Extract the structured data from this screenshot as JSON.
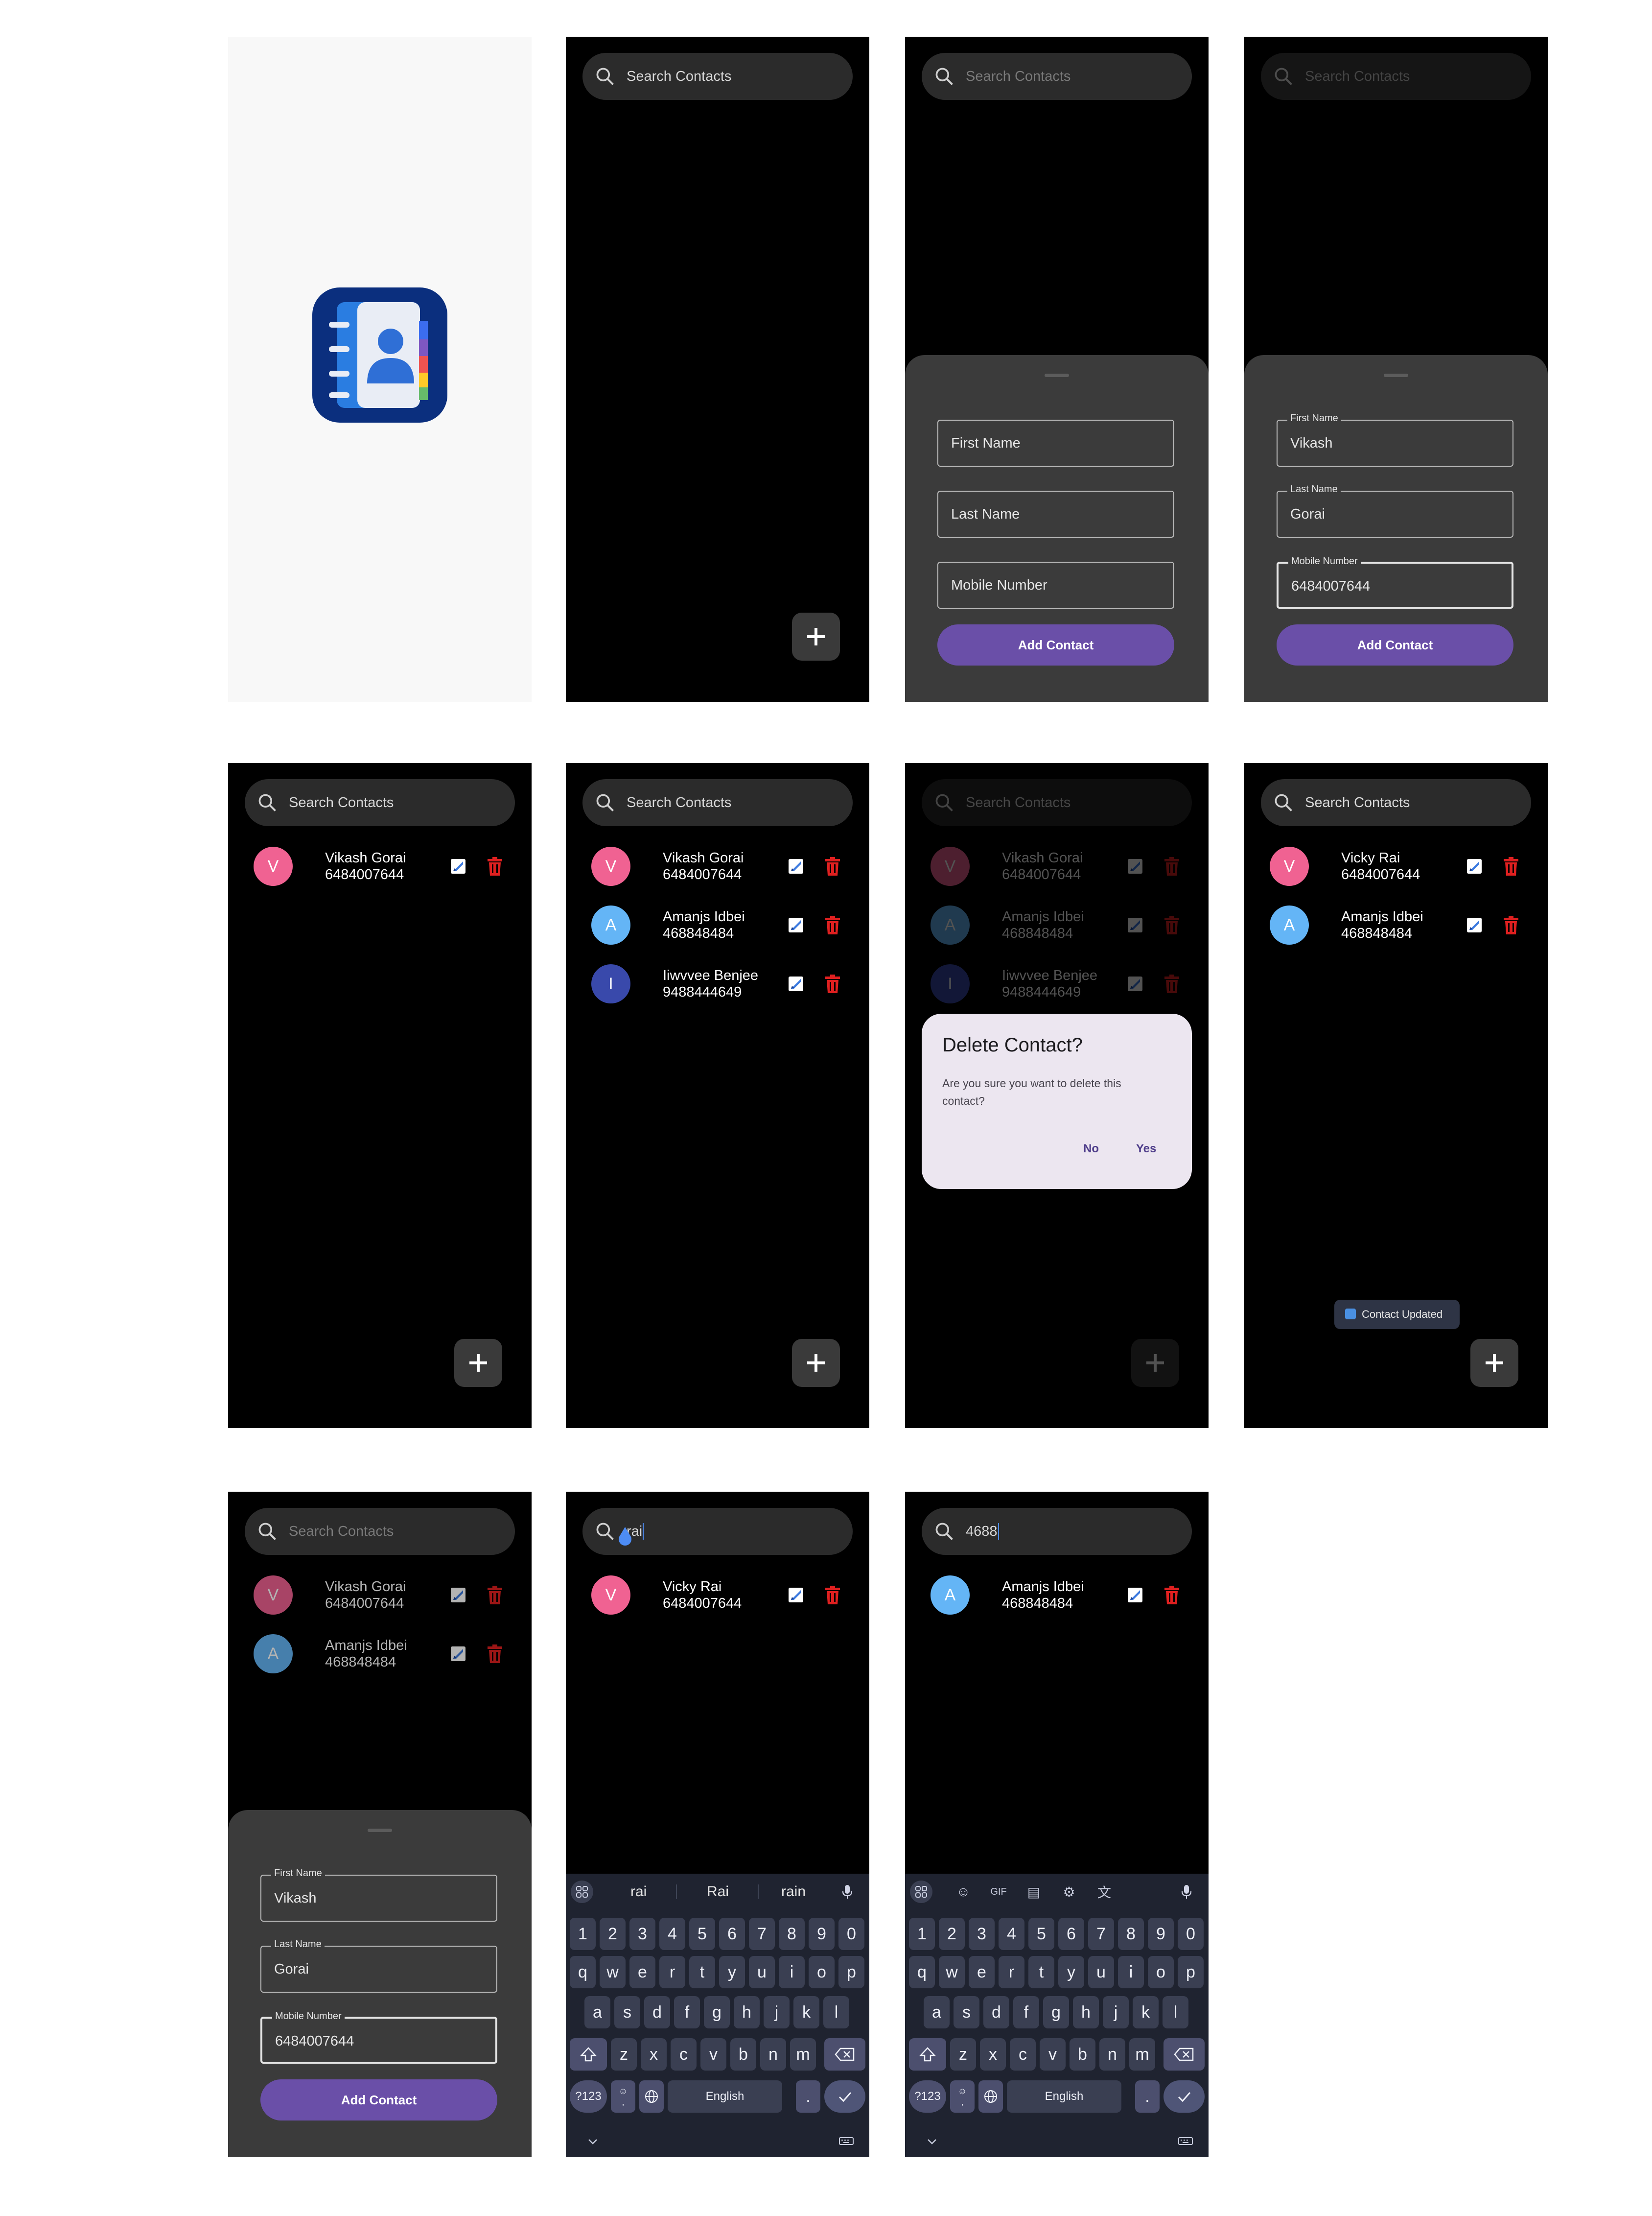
{
  "search": {
    "placeholder": "Search Contacts"
  },
  "queries": {
    "rai": "rai",
    "num": "4688"
  },
  "form": {
    "first_name": "First Name",
    "last_name": "Last Name",
    "mobile": "Mobile Number",
    "button": "Add Contact",
    "values": {
      "first": "Vikash",
      "last": "Gorai",
      "mobile": "6484007644"
    }
  },
  "contacts": [
    {
      "initial": "V",
      "name": "Vikash Gorai",
      "phone": "6484007644",
      "color": "#f06292"
    },
    {
      "initial": "A",
      "name": "Amanjs Idbei",
      "phone": "468848484",
      "color": "#64b5f6"
    },
    {
      "initial": "I",
      "name": "Iiwvvee Benjee",
      "phone": "9488444649",
      "color": "#3949ab"
    },
    {
      "initial": "V",
      "name": "Vicky Rai",
      "phone": "6484007644",
      "color": "#f06292"
    }
  ],
  "dialog": {
    "title": "Delete Contact?",
    "body": "Are you sure you want to delete this contact?",
    "no": "No",
    "yes": "Yes"
  },
  "toast": "Contact Updated",
  "keyboard": {
    "suggestions": [
      "rai",
      "Rai",
      "rain"
    ],
    "row1": [
      "1",
      "2",
      "3",
      "4",
      "5",
      "6",
      "7",
      "8",
      "9",
      "0"
    ],
    "row2": [
      "q",
      "w",
      "e",
      "r",
      "t",
      "y",
      "u",
      "i",
      "o",
      "p"
    ],
    "row3": [
      "a",
      "s",
      "d",
      "f",
      "g",
      "h",
      "j",
      "k",
      "l"
    ],
    "row4": [
      "z",
      "x",
      "c",
      "v",
      "b",
      "n",
      "m"
    ],
    "sym": "?123",
    "space": "English",
    "comma_emoji": "☺\n,",
    "period": ".",
    "gif": "GIF"
  }
}
